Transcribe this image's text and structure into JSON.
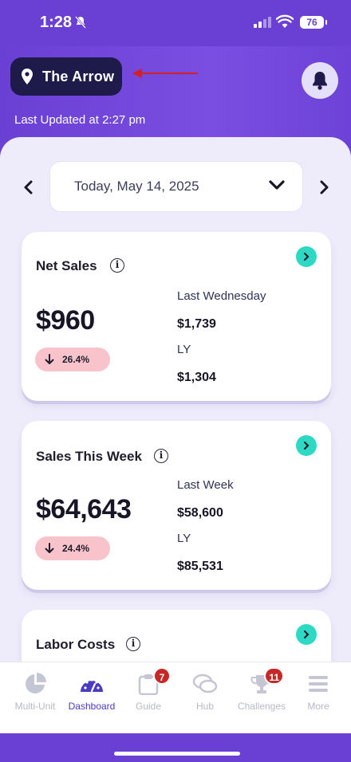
{
  "status_bar": {
    "time": "1:28",
    "battery": "76"
  },
  "header": {
    "store_name": "The Arrow",
    "last_updated": "Last Updated at 2:27 pm"
  },
  "date_selector": {
    "label": "Today, May 14, 2025"
  },
  "cards": {
    "net_sales": {
      "title": "Net Sales",
      "value": "$960",
      "change": "26.4%",
      "cmp1_label": "Last Wednesday",
      "cmp1_value": "$1,739",
      "cmp2_label": "LY",
      "cmp2_value": "$1,304"
    },
    "sales_week": {
      "title": "Sales This Week",
      "value": "$64,643",
      "change": "24.4%",
      "cmp1_label": "Last Week",
      "cmp1_value": "$58,600",
      "cmp2_label": "LY",
      "cmp2_value": "$85,531"
    },
    "labor_costs": {
      "title": "Labor Costs"
    }
  },
  "tabs": [
    {
      "label": "Multi-Unit",
      "icon": "pie-chart-icon"
    },
    {
      "label": "Dashboard",
      "icon": "gauge-icon",
      "active": true
    },
    {
      "label": "Guide",
      "icon": "clipboard-icon",
      "badge": "7"
    },
    {
      "label": "Hub",
      "icon": "chat-bubbles-icon"
    },
    {
      "label": "Challenges",
      "icon": "trophy-icon",
      "badge": "11"
    },
    {
      "label": "More",
      "icon": "menu-icon"
    }
  ],
  "colors": {
    "brand_purple": "#6a3fd4",
    "pill_navy": "#1e1b4b",
    "accent_teal": "#2ed9c3",
    "down_badge": "#f9c3cb",
    "badge_red": "#c62828",
    "active_tab": "#4a3bc4"
  }
}
